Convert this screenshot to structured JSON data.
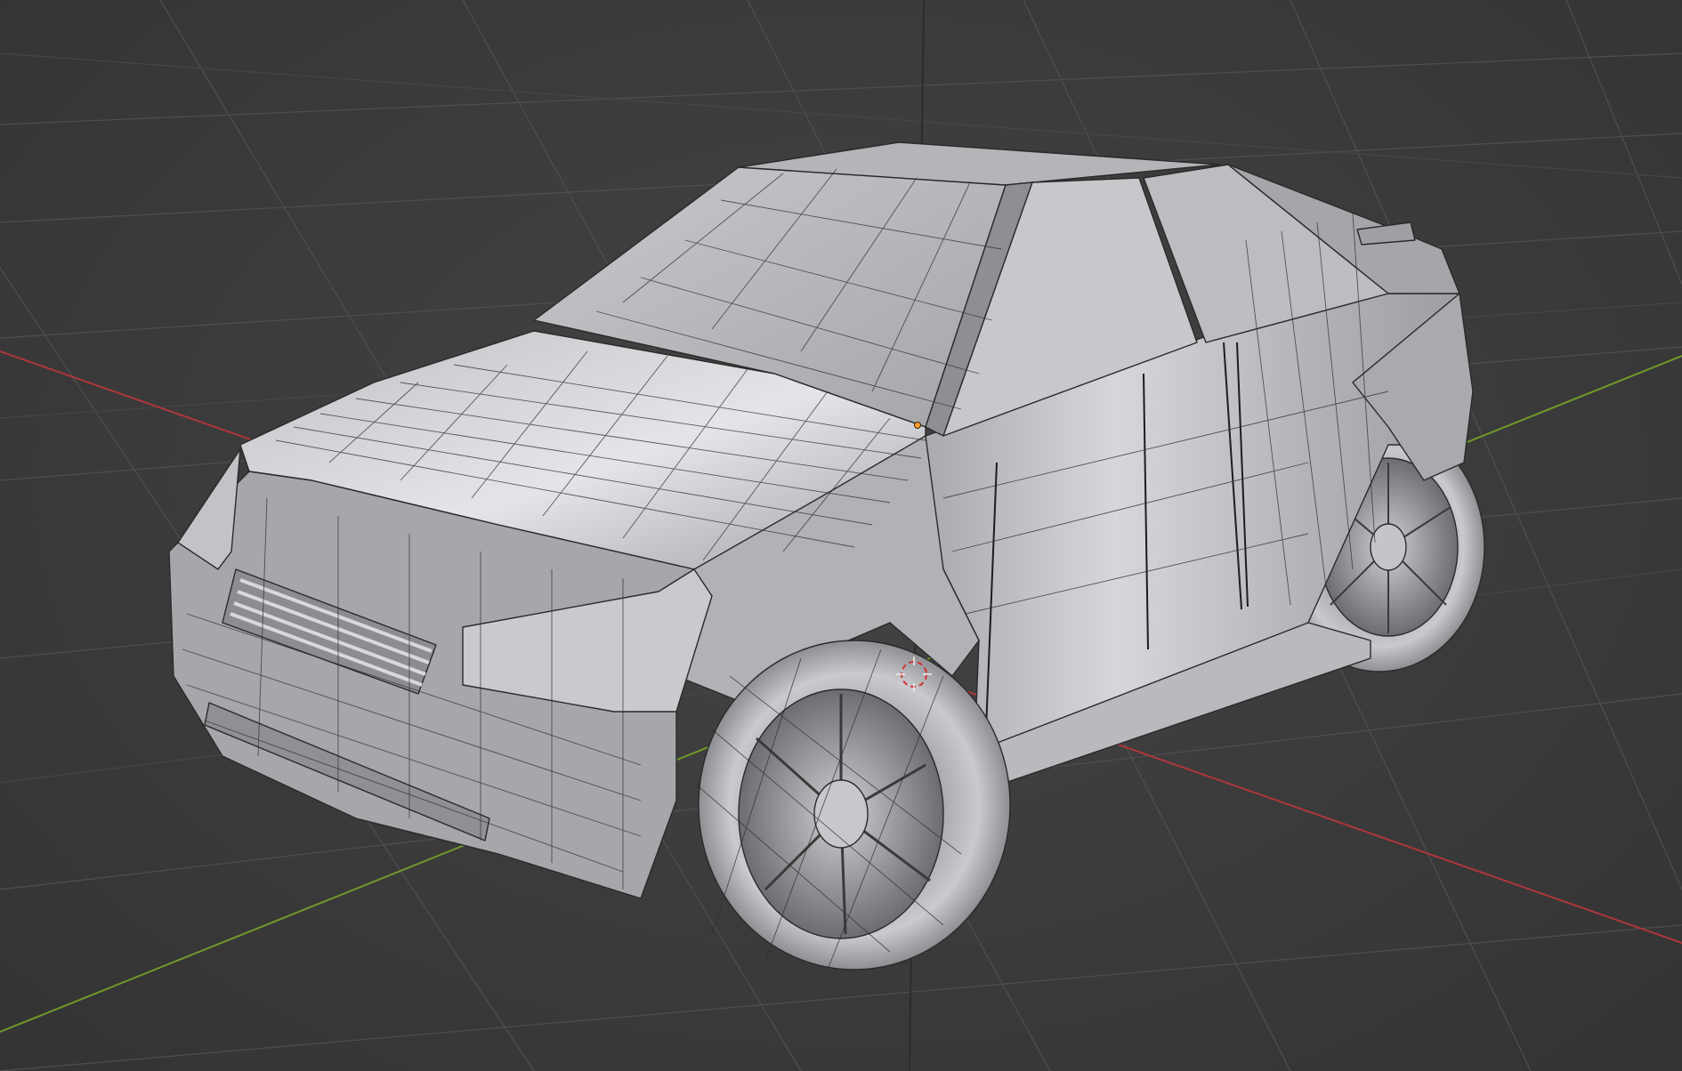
{
  "viewport": {
    "label": "",
    "background_color": "#3d3d3d",
    "grid_color": "#505050",
    "axis_x_color": "#b0353d",
    "axis_y_color": "#6f9a2a",
    "axis_z_color": "#2f2f2f",
    "selected_vertex_color": "#ffa030",
    "origin_marker_color": "#d33030"
  },
  "scene": {
    "object": "car-mesh",
    "shading": "solid",
    "wireframe_overlay": true
  }
}
